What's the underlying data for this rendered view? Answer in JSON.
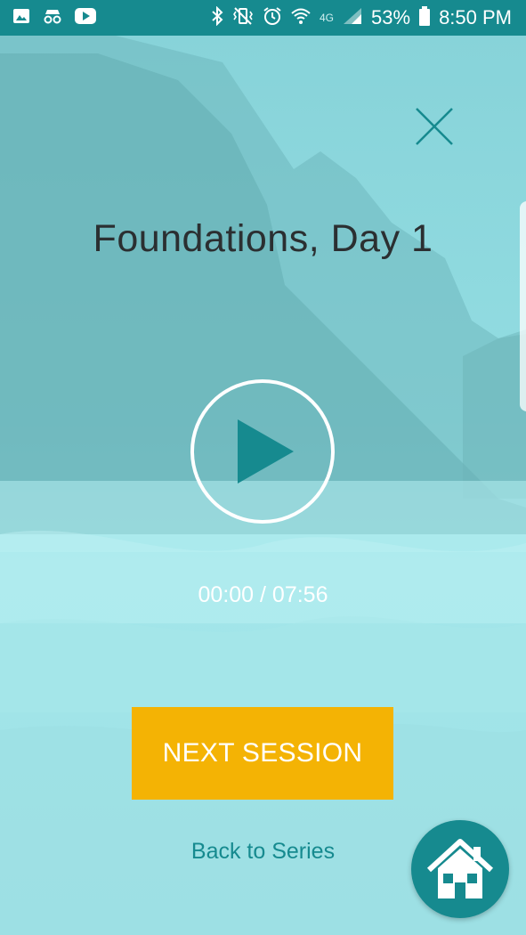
{
  "status_bar": {
    "left_icons": [
      "image-icon",
      "incognito-icon",
      "youtube-icon"
    ],
    "right_icons": [
      "bluetooth-icon",
      "vibrate-icon",
      "alarm-icon",
      "wifi-icon",
      "lte-icon",
      "signal-icon",
      "battery-icon"
    ],
    "network_label": "4G",
    "battery_percent": "53%",
    "time": "8:50 PM"
  },
  "session": {
    "title": "Foundations, Day 1",
    "elapsed": "00:00",
    "duration": "07:56",
    "time_display": "00:00 / 07:56",
    "progress": 0
  },
  "actions": {
    "next_label": "NEXT SESSION",
    "back_label": "Back to Series",
    "close_icon": "close-icon",
    "play_icon": "play-icon",
    "home_icon": "home-icon"
  },
  "colors": {
    "accent_teal": "#168a8f",
    "next_button": "#f4b304",
    "title_text": "#2b2f31"
  }
}
